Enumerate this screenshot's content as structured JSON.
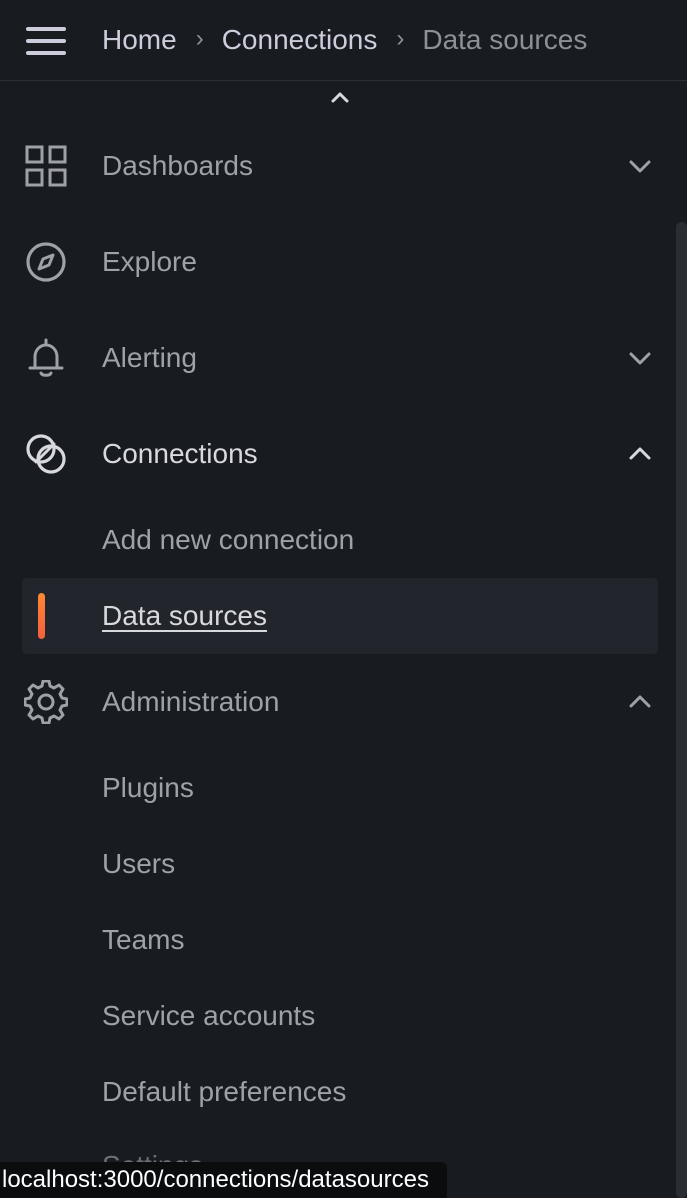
{
  "breadcrumb": {
    "items": [
      "Home",
      "Connections"
    ],
    "current": "Data sources"
  },
  "nav": {
    "dashboards": "Dashboards",
    "explore": "Explore",
    "alerting": "Alerting",
    "connections": "Connections",
    "connections_children": [
      "Add new connection",
      "Data sources"
    ],
    "administration": "Administration",
    "administration_children": [
      "Plugins",
      "Users",
      "Teams",
      "Service accounts",
      "Default preferences",
      "Settings"
    ]
  },
  "status_url": "localhost:3000/connections/datasources",
  "icons": {
    "menu": "hamburger-menu-icon",
    "dashboards": "apps-grid-icon",
    "explore": "compass-icon",
    "alerting": "bell-icon",
    "connections": "link-rings-icon",
    "administration": "cog-icon"
  },
  "colors": {
    "background": "#181b1f",
    "active_bar": "#ff7a33",
    "active_bg": "#22252b",
    "text_primary": "#d8d9df",
    "text_secondary": "#9fa1a9"
  }
}
